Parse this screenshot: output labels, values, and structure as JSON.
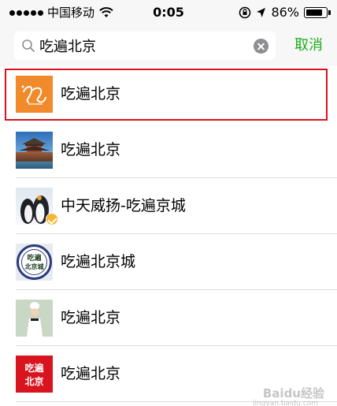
{
  "status_bar": {
    "carrier": "中国移动",
    "time": "0:05",
    "battery_text": "86%",
    "battery_level": 0.86,
    "signal_icon": "signal-dots-icon",
    "wifi_icon": "wifi-icon",
    "rotation_lock_icon": "rotation-lock-icon",
    "location_icon": "location-arrow-icon",
    "battery_icon": "battery-icon"
  },
  "search": {
    "value": "吃遍北京",
    "icon": "search-icon",
    "clear_icon": "clear-icon",
    "cancel_label": "取消"
  },
  "results": [
    {
      "label": "吃遍北京",
      "avatar_text": "",
      "highlighted": true
    },
    {
      "label": "吃遍北京",
      "avatar_text": "",
      "highlighted": false
    },
    {
      "label": "中天威扬-吃遍京城",
      "avatar_text": "",
      "highlighted": false,
      "verified": true
    },
    {
      "label": "吃遍北京城",
      "avatar_text": "吃遍 北京城",
      "highlighted": false
    },
    {
      "label": "吃遍北京",
      "avatar_text": "",
      "highlighted": false
    },
    {
      "label": "吃遍北京",
      "avatar_text": "吃遍 北京",
      "highlighted": false
    }
  ],
  "watermark": {
    "text": "Baidu经验",
    "sub": "jingyan.baidu.com"
  },
  "colors": {
    "accent_green": "#1aad19",
    "highlight_red": "#d9121c",
    "verified_gold": "#f5b731"
  }
}
